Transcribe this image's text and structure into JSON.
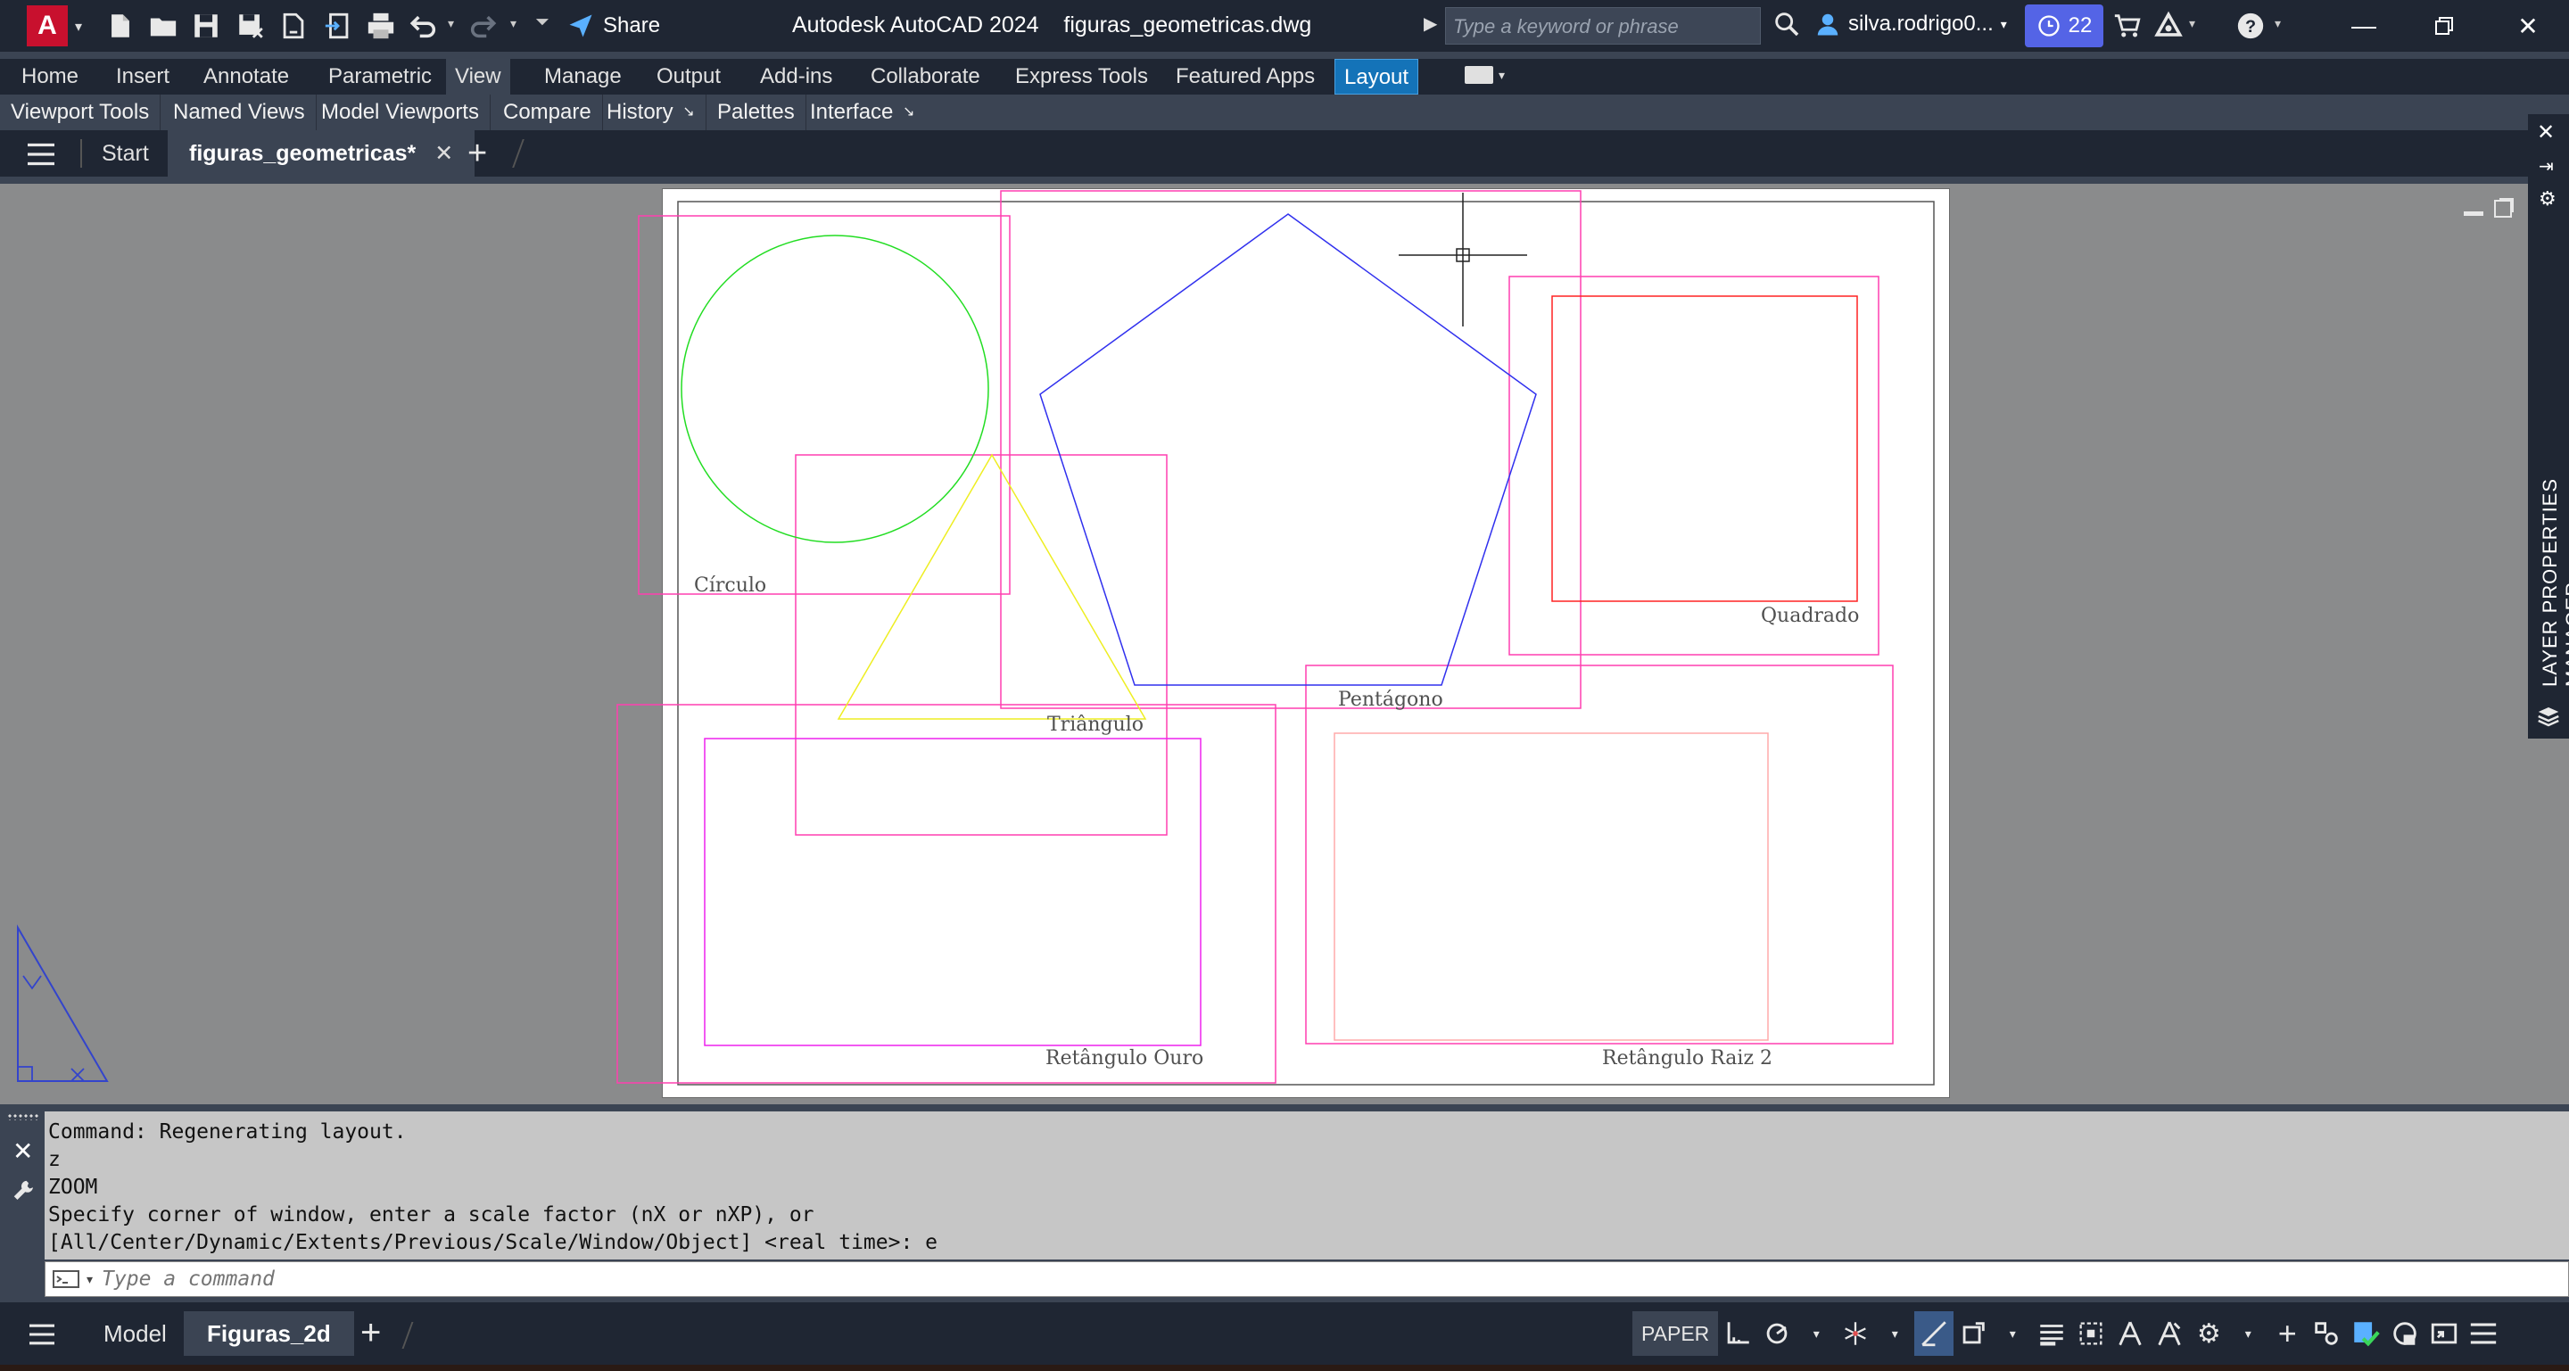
{
  "titlebar": {
    "logo_letter": "A",
    "share_label": "Share",
    "app_title": "Autodesk AutoCAD 2024",
    "file_title": "figuras_geometricas.dwg",
    "search_placeholder": "Type a keyword or phrase",
    "user_name": "silva.rodrigo0...",
    "trial_count": "22",
    "help_label": "?"
  },
  "ribbon": {
    "tabs": [
      "Home",
      "Insert",
      "Annotate",
      "Parametric",
      "View",
      "Manage",
      "Output",
      "Add-ins",
      "Collaborate",
      "Express Tools",
      "Featured Apps",
      "Layout"
    ],
    "active_tab": "View",
    "panels": [
      "Viewport Tools",
      "Named Views",
      "Model Viewports",
      "Compare",
      "History",
      "Palettes",
      "Interface"
    ]
  },
  "file_tabs": {
    "start_label": "Start",
    "active_file": "figuras_geometricas*"
  },
  "drawing": {
    "labels": {
      "circle": "Círculo",
      "square": "Quadrado",
      "pentagon": "Pentágono",
      "triangle": "Triângulo",
      "golden_rect": "Retângulo Ouro",
      "root2_rect": "Retângulo Raiz 2"
    },
    "colors": {
      "viewport": "#ff3fb0",
      "circle": "#22dd22",
      "pentagon": "#3030ee",
      "triangle": "#eeee22",
      "square": "#ff2222",
      "golden_rect": "#ee22ee",
      "root2_rect": "#ffaaaa"
    }
  },
  "palette": {
    "layer_manager_label": "LAYER PROPERTIES MANAGER"
  },
  "command": {
    "history": [
      "Command: Regenerating layout.",
      "z",
      "ZOOM",
      "Specify corner of window, enter a scale factor (nX or nXP), or",
      "[All/Center/Dynamic/Extents/Previous/Scale/Window/Object] <real time>: e"
    ],
    "input_placeholder": "Type a command"
  },
  "status": {
    "layout_tabs": [
      "Model",
      "Figuras_2d"
    ],
    "active_layout": "Figuras_2d",
    "space_label": "PAPER"
  }
}
